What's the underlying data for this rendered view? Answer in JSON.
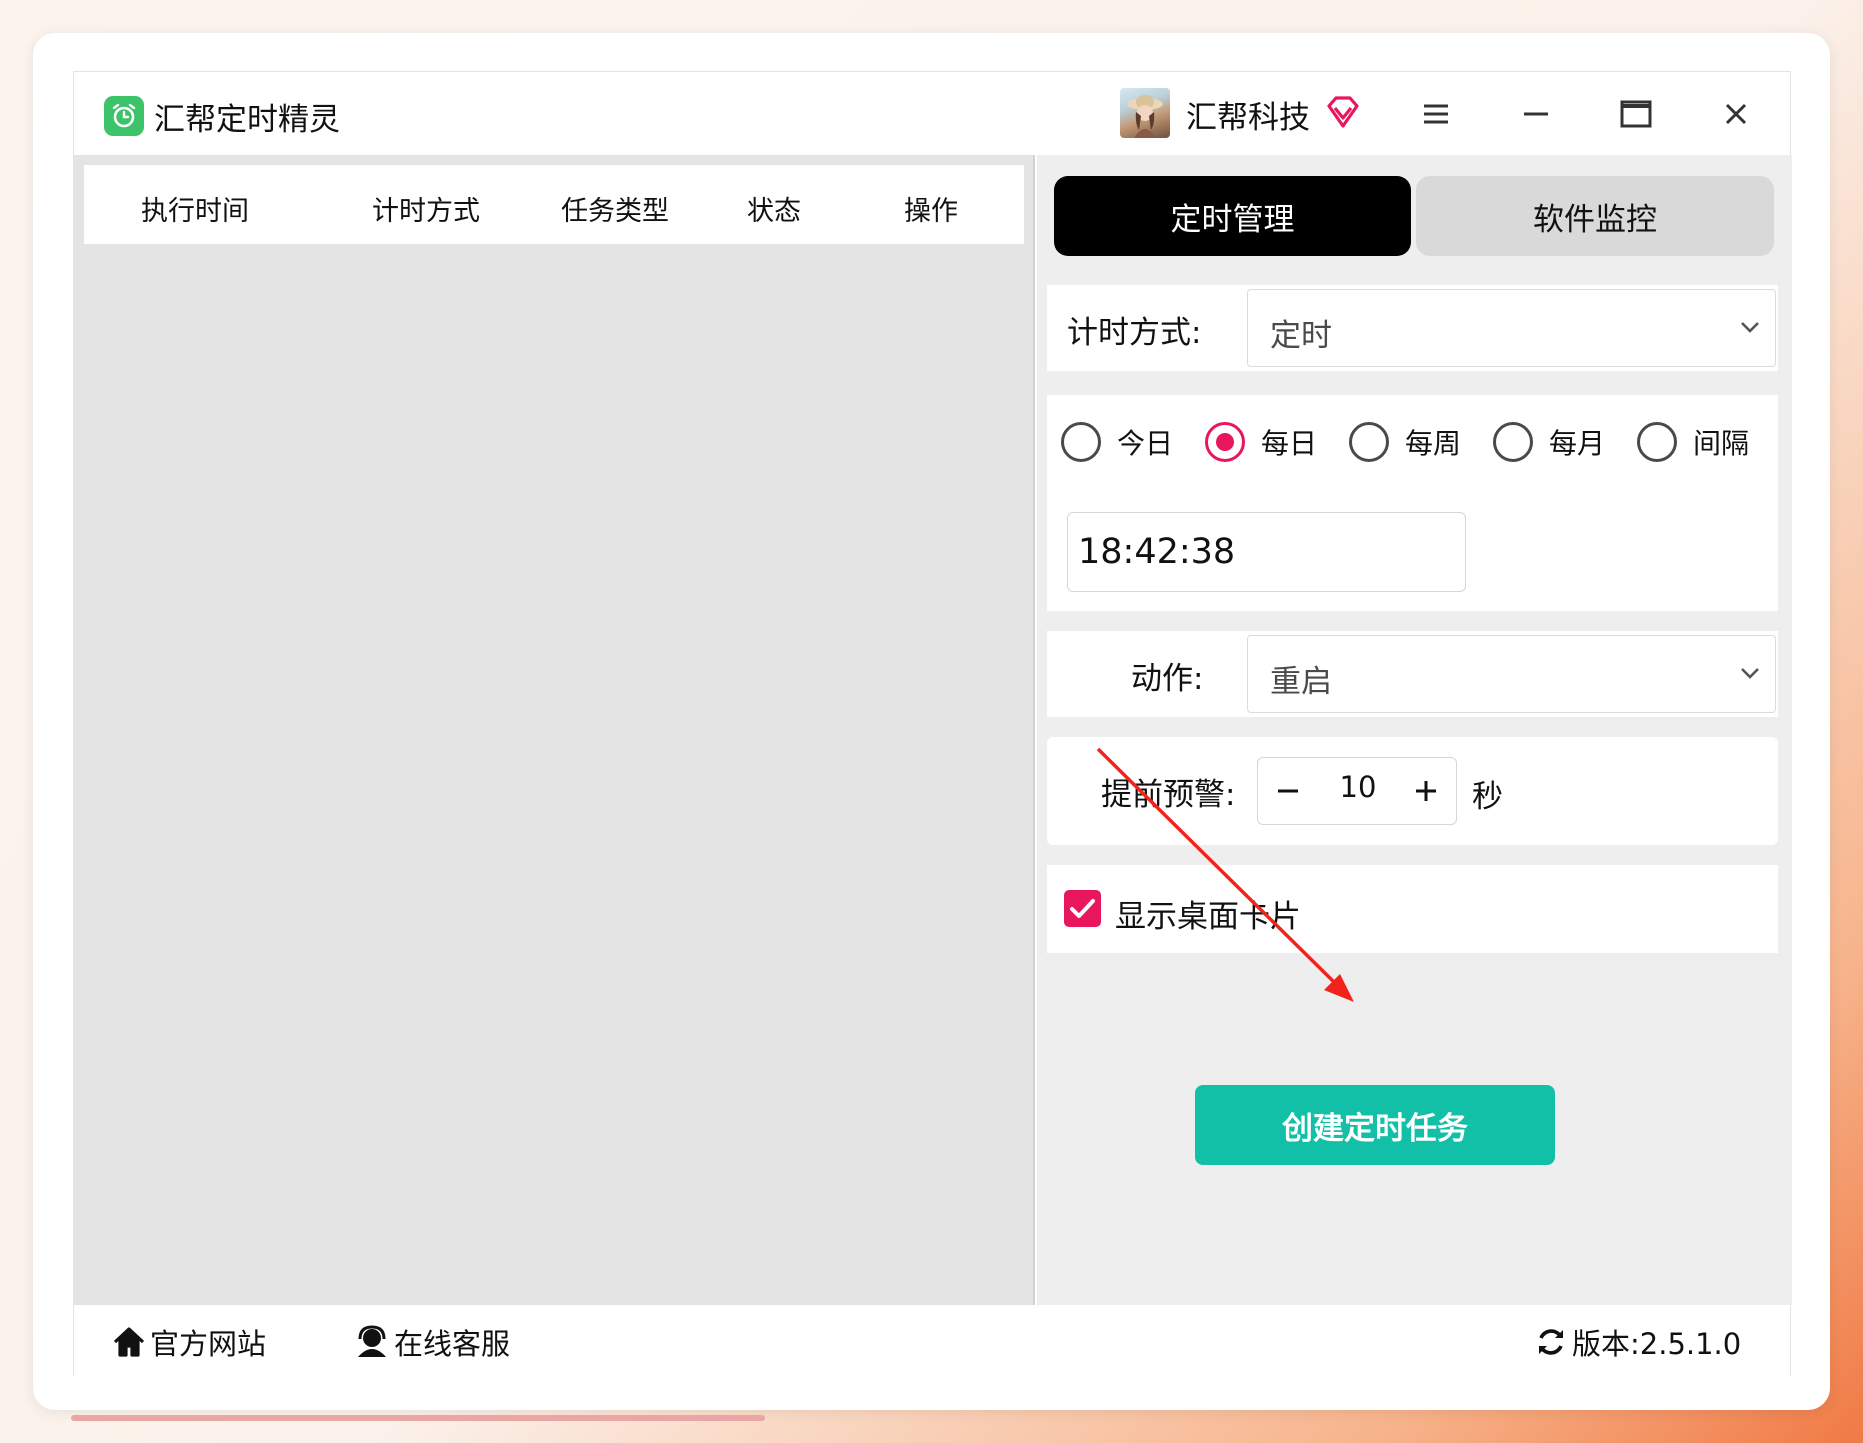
{
  "app": {
    "title": "汇帮定时精灵",
    "company": "汇帮科技"
  },
  "table": {
    "headers": [
      "执行时间",
      "计时方式",
      "任务类型",
      "状态",
      "操作"
    ]
  },
  "tabs": [
    {
      "label": "定时管理",
      "active": true
    },
    {
      "label": "软件监控",
      "active": false
    }
  ],
  "form": {
    "timer_mode_label": "计时方式:",
    "timer_mode_value": "定时",
    "frequency_options": [
      {
        "label": "今日",
        "checked": false
      },
      {
        "label": "每日",
        "checked": true
      },
      {
        "label": "每周",
        "checked": false
      },
      {
        "label": "每月",
        "checked": false
      },
      {
        "label": "间隔",
        "checked": false
      }
    ],
    "time_value": "18:42:38",
    "action_label": "动作:",
    "action_value": "重启",
    "warning_label": "提前预警:",
    "warning_value": "10",
    "warning_unit": "秒",
    "show_card_label": "显示桌面卡片",
    "show_card_checked": true,
    "create_button": "创建定时任务"
  },
  "footer": {
    "website": "官方网站",
    "service": "在线客服",
    "version": "版本:2.5.1.0"
  },
  "colors": {
    "accent_pink": "#e8175d",
    "create_button": "#12bfa7",
    "logo_green": "#3cc36a",
    "annotation_arrow": "#f2231d"
  }
}
